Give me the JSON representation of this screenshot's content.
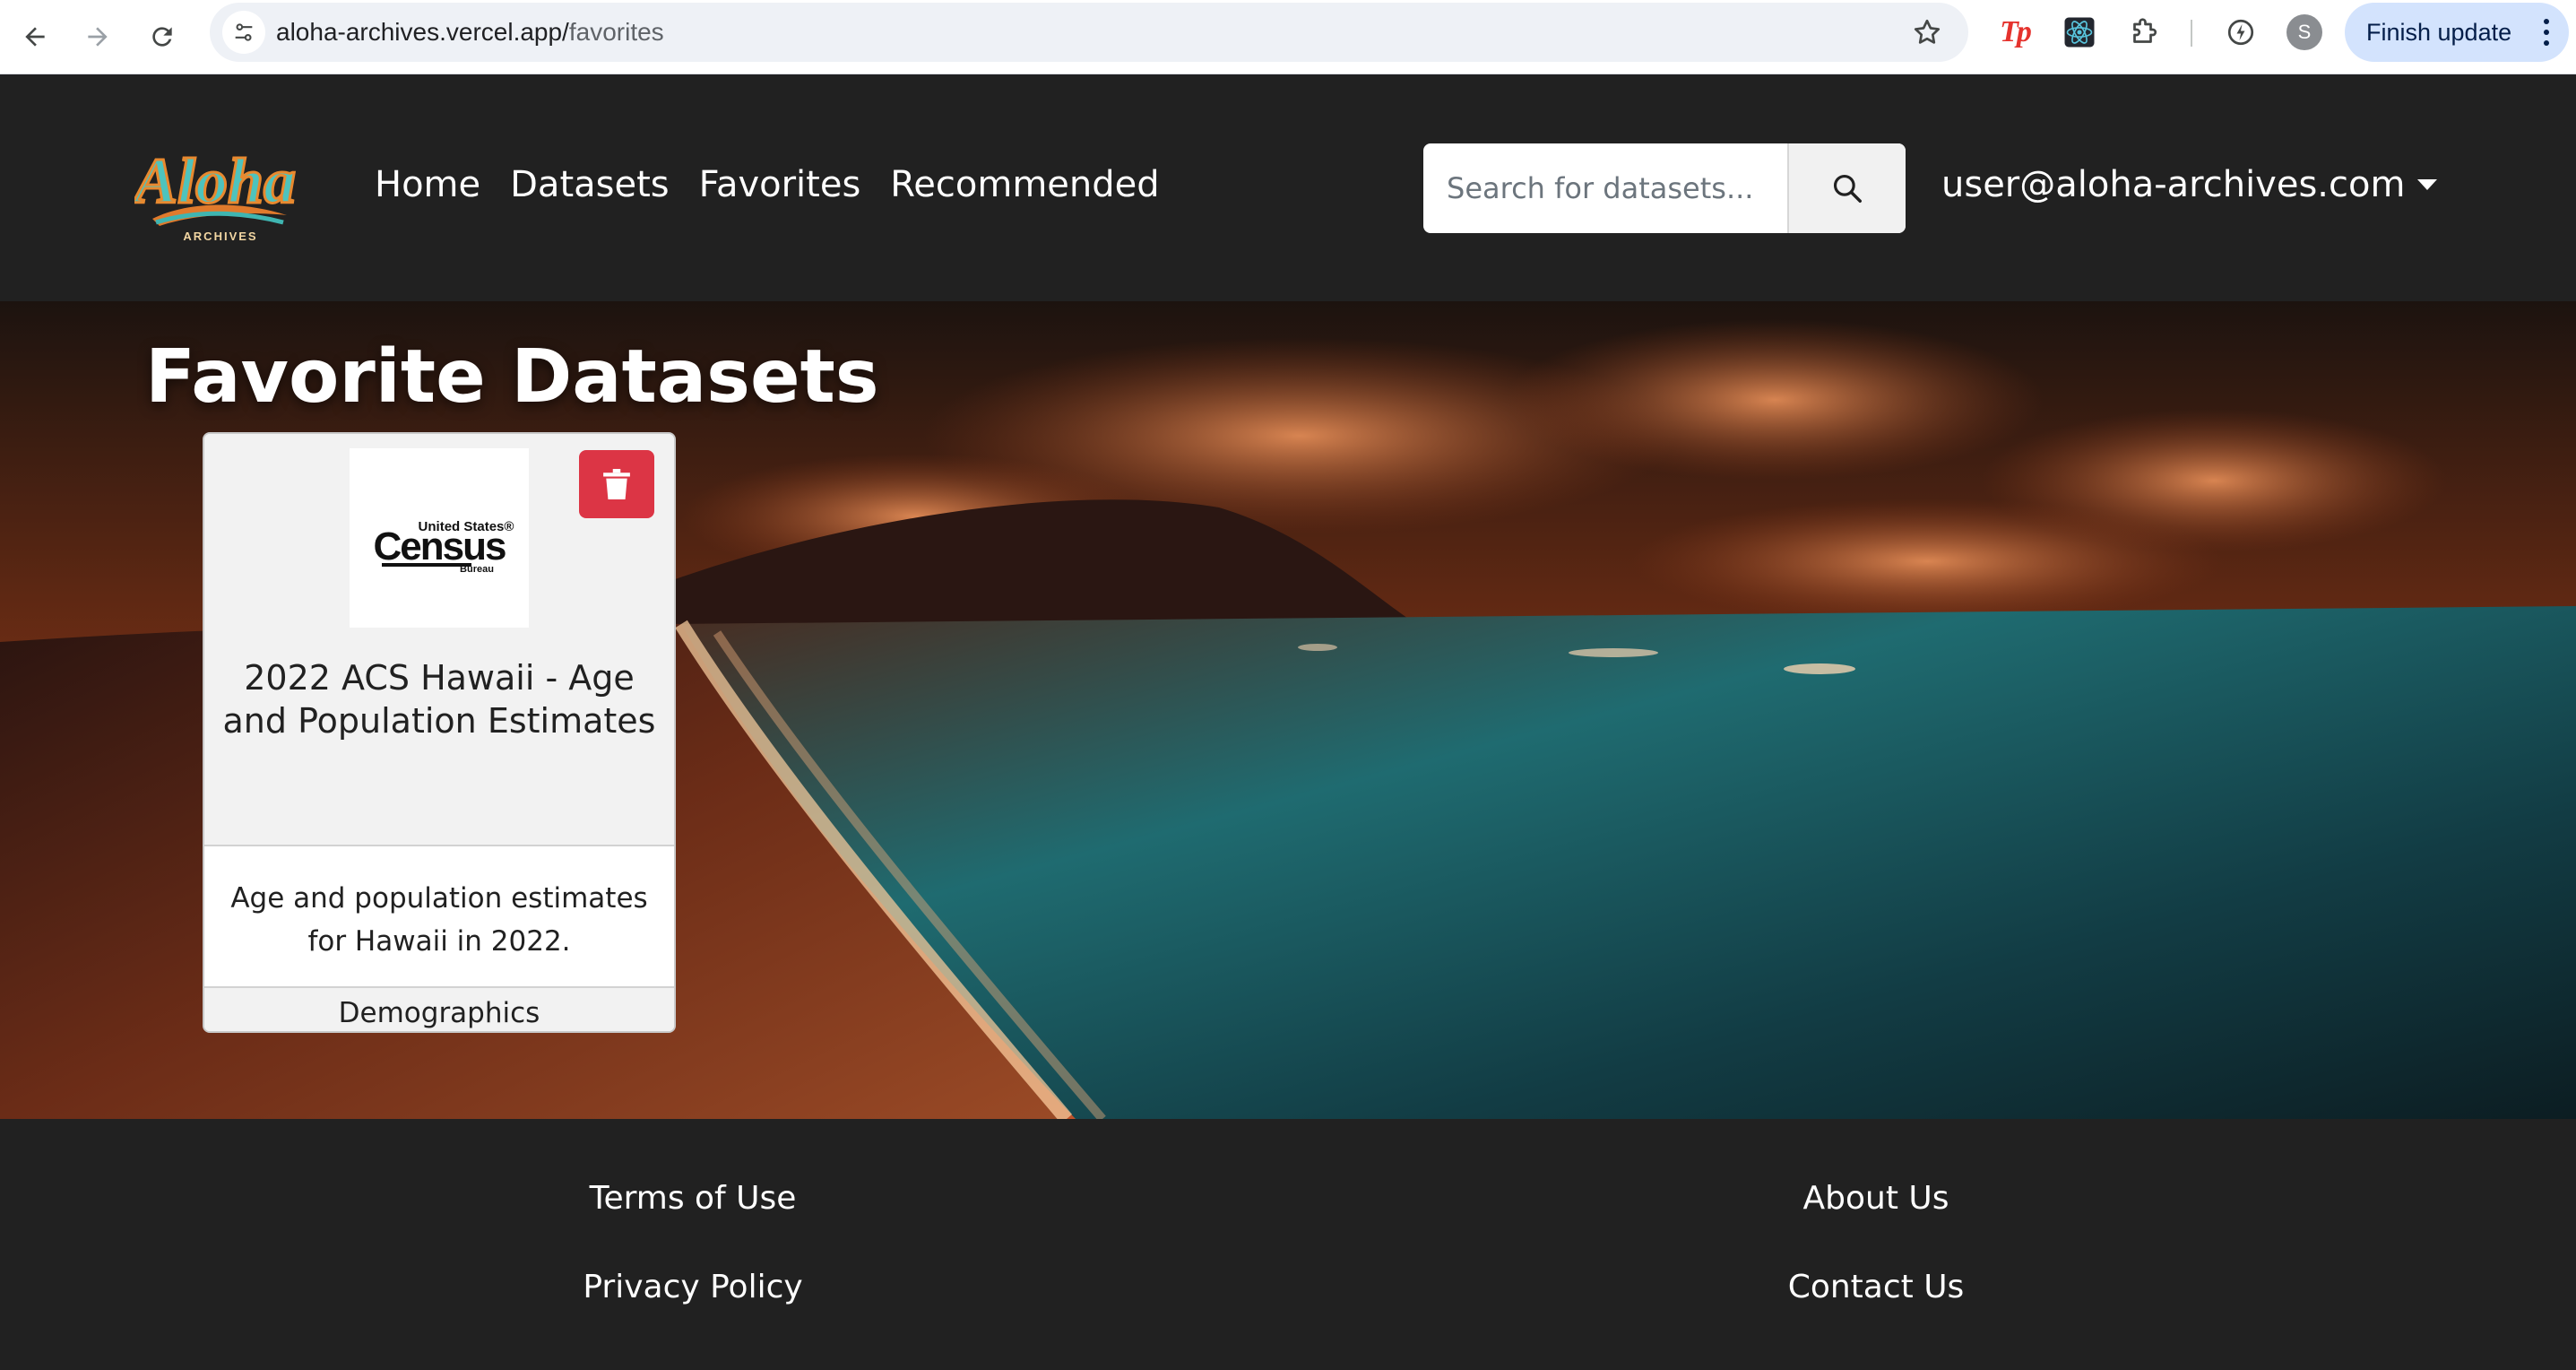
{
  "browser": {
    "url_host": "aloha-archives.vercel.app/",
    "url_path": "favorites",
    "profile_initial": "S",
    "finish_update_label": "Finish update",
    "extensions": [
      "tp-extension-icon",
      "react-devtools-icon",
      "puzzle-extensions-icon",
      "performance-icon"
    ]
  },
  "navbar": {
    "logo_text": "Aloha",
    "logo_subtext": "ARCHIVES",
    "links": [
      "Home",
      "Datasets",
      "Favorites",
      "Recommended"
    ],
    "search_placeholder": "Search for datasets...",
    "user_email": "user@aloha-archives.com"
  },
  "page": {
    "title": "Favorite Datasets"
  },
  "favorites": [
    {
      "logo_top": "United States®",
      "logo_main": "Census",
      "logo_bottom": "Bureau",
      "title": "2022 ACS Hawaii - Age and Population Estimates",
      "description": "Age and population estimates for Hawaii in 2022.",
      "topic": "Demographics"
    }
  ],
  "footer": {
    "terms": "Terms of Use",
    "privacy": "Privacy Policy",
    "about": "About Us",
    "contact": "Contact Us"
  },
  "colors": {
    "navbar_bg": "#212121",
    "delete_red": "#dc3545",
    "sunset_orange": "#c0522a",
    "ocean_teal": "#1f6b70"
  }
}
